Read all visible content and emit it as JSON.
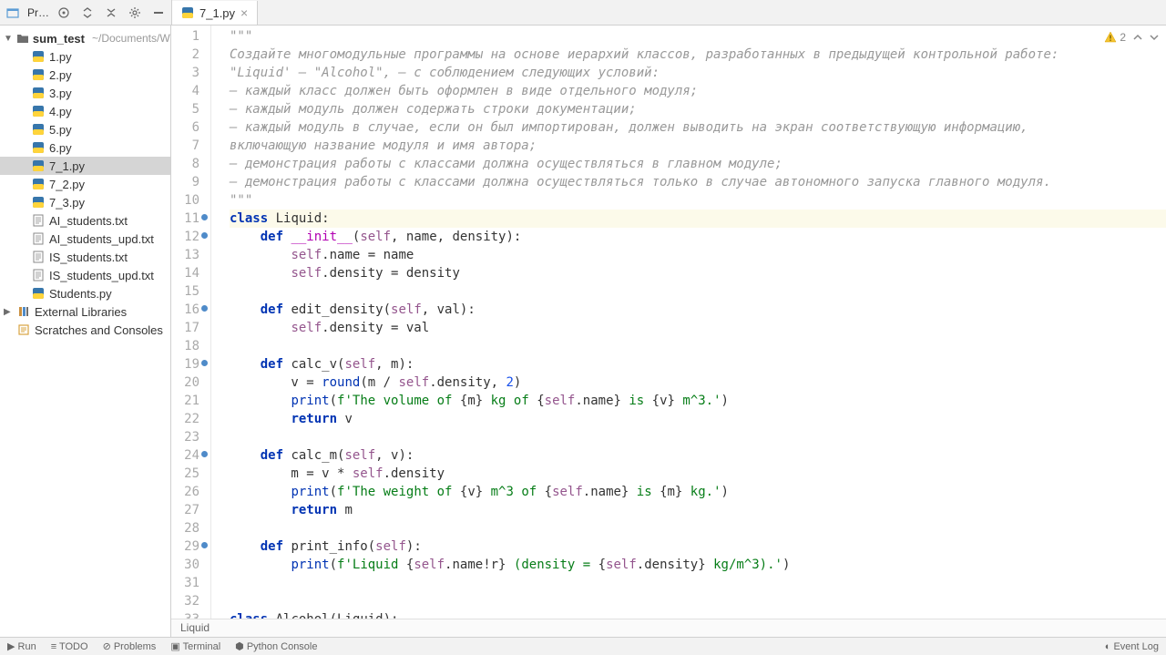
{
  "toolbar": {
    "project_label": "Pr…"
  },
  "tab": {
    "name": "7_1.py"
  },
  "inspections": {
    "warnings": "2"
  },
  "tree": {
    "root": {
      "name": "sum_test",
      "path": "~/Documents/W"
    },
    "files": [
      {
        "name": "1.py",
        "type": "py"
      },
      {
        "name": "2.py",
        "type": "py"
      },
      {
        "name": "3.py",
        "type": "py"
      },
      {
        "name": "4.py",
        "type": "py"
      },
      {
        "name": "5.py",
        "type": "py"
      },
      {
        "name": "6.py",
        "type": "py"
      },
      {
        "name": "7_1.py",
        "type": "py",
        "selected": true
      },
      {
        "name": "7_2.py",
        "type": "py"
      },
      {
        "name": "7_3.py",
        "type": "py"
      },
      {
        "name": "AI_students.txt",
        "type": "txt"
      },
      {
        "name": "AI_students_upd.txt",
        "type": "txt"
      },
      {
        "name": "IS_students.txt",
        "type": "txt"
      },
      {
        "name": "IS_students_upd.txt",
        "type": "txt"
      },
      {
        "name": "Students.py",
        "type": "py"
      }
    ],
    "external": "External Libraries",
    "scratches": "Scratches and Consoles"
  },
  "code": {
    "lines": [
      {
        "n": 1,
        "t": "comment",
        "text": "\"\"\""
      },
      {
        "n": 2,
        "t": "comment",
        "text": "Создайте многомодульные программы на основе иерархий классов, разработанных в предыдущей контрольной работе:"
      },
      {
        "n": 3,
        "t": "comment",
        "text": "\"Liquid' – \"Alcohol\", – с соблюдением следующих условий:"
      },
      {
        "n": 4,
        "t": "comment",
        "text": "– каждый класс должен быть оформлен в виде отдельного модуля;"
      },
      {
        "n": 5,
        "t": "comment",
        "text": "– каждый модуль должен содержать строки документации;"
      },
      {
        "n": 6,
        "t": "comment",
        "text": "– каждый модуль в случае, если он был импортирован, должен выводить на экран соответствующую информацию,"
      },
      {
        "n": 7,
        "t": "comment",
        "text": "включающую название модуля и имя автора;"
      },
      {
        "n": 8,
        "t": "comment",
        "text": "– демонстрация работы с классами должна осуществляться в главном модуле;"
      },
      {
        "n": 9,
        "t": "comment",
        "text": "– демонстрация работы с классами должна осуществляться только в случае автономного запуска главного модуля."
      },
      {
        "n": 10,
        "t": "comment",
        "text": "\"\"\""
      },
      {
        "n": 11,
        "t": "code",
        "html": "<span class='tok-keyword'>class</span> <span class='tok-class'>Liquid</span>:",
        "highlight": true,
        "mark": true
      },
      {
        "n": 12,
        "t": "code",
        "html": "    <span class='tok-def'>def</span> <span class='tok-dunder'>__init__</span>(<span class='tok-self'>self</span>, name, density):",
        "mark": true
      },
      {
        "n": 13,
        "t": "code",
        "html": "        <span class='tok-self'>self</span>.name = name"
      },
      {
        "n": 14,
        "t": "code",
        "html": "        <span class='tok-self'>self</span>.density = density"
      },
      {
        "n": 15,
        "t": "code",
        "html": ""
      },
      {
        "n": 16,
        "t": "code",
        "html": "    <span class='tok-def'>def</span> edit_density(<span class='tok-self'>self</span>, val):",
        "mark": true
      },
      {
        "n": 17,
        "t": "code",
        "html": "        <span class='tok-self'>self</span>.density = val"
      },
      {
        "n": 18,
        "t": "code",
        "html": ""
      },
      {
        "n": 19,
        "t": "code",
        "html": "    <span class='tok-def'>def</span> calc_v(<span class='tok-self'>self</span>, m):",
        "mark": true
      },
      {
        "n": 20,
        "t": "code",
        "html": "        v = <span class='tok-builtin'>round</span>(m / <span class='tok-self'>self</span>.density, <span class='tok-num'>2</span>)"
      },
      {
        "n": 21,
        "t": "code",
        "html": "        <span class='tok-builtin'>print</span>(<span class='tok-string'>f'The volume of </span>{m}<span class='tok-string'> kg of </span>{<span class='tok-self'>self</span>.name}<span class='tok-string'> is </span>{v}<span class='tok-string'> m^3.'</span>)"
      },
      {
        "n": 22,
        "t": "code",
        "html": "        <span class='tok-keyword'>return</span> v"
      },
      {
        "n": 23,
        "t": "code",
        "html": ""
      },
      {
        "n": 24,
        "t": "code",
        "html": "    <span class='tok-def'>def</span> calc_m(<span class='tok-self'>self</span>, v):",
        "mark": true
      },
      {
        "n": 25,
        "t": "code",
        "html": "        m = v * <span class='tok-self'>self</span>.density"
      },
      {
        "n": 26,
        "t": "code",
        "html": "        <span class='tok-builtin'>print</span>(<span class='tok-string'>f'The weight of </span>{v}<span class='tok-string'> m^3 of </span>{<span class='tok-self'>self</span>.name}<span class='tok-string'> is </span>{m}<span class='tok-string'> kg.'</span>)"
      },
      {
        "n": 27,
        "t": "code",
        "html": "        <span class='tok-keyword'>return</span> m"
      },
      {
        "n": 28,
        "t": "code",
        "html": ""
      },
      {
        "n": 29,
        "t": "code",
        "html": "    <span class='tok-def'>def</span> print_info(<span class='tok-self'>self</span>):",
        "mark": true
      },
      {
        "n": 30,
        "t": "code",
        "html": "        <span class='tok-builtin'>print</span>(<span class='tok-string'>f'Liquid </span>{<span class='tok-self'>self</span>.name!r}<span class='tok-string'> (density = </span>{<span class='tok-self'>self</span>.density}<span class='tok-string'> kg/m^3).'</span>)"
      },
      {
        "n": 31,
        "t": "code",
        "html": ""
      },
      {
        "n": 32,
        "t": "code",
        "html": ""
      },
      {
        "n": 33,
        "t": "code",
        "html": "<span class='tok-keyword'>class</span> <span class='tok-class'>Alcohol</span>(Liquid):"
      }
    ]
  },
  "breadcrumb": "Liquid",
  "bottom": {
    "run": "Run",
    "todo": "TODO",
    "problems": "Problems",
    "terminal": "Terminal",
    "python_console": "Python Console",
    "event_log": "Event Log"
  }
}
